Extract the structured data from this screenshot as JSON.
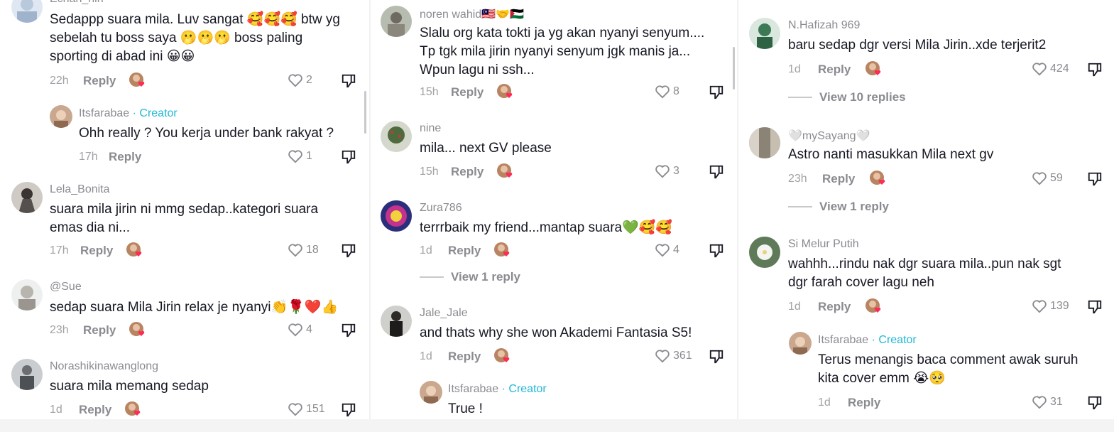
{
  "column1": {
    "c1": {
      "user": "Echan_nin",
      "lines": [
        "Sedappp suara mila. Luv sangat 🥰🥰🥰 btw yg",
        "sebelah tu boss saya 🫢🫢🫢 boss paling",
        "sporting di abad ini 😀😀"
      ],
      "time": "22h",
      "reply": "Reply",
      "likes": "2"
    },
    "c2": {
      "user": "Itsfarabae",
      "creator": "· Creator",
      "lines": [
        "Ohh really ? You kerja under bank rakyat ?"
      ],
      "time": "17h",
      "reply": "Reply",
      "likes": "1"
    },
    "c3": {
      "user": "Lela_Bonita",
      "lines": [
        "suara mila jirin ni mmg sedap..kategori suara",
        "emas dia ni..."
      ],
      "time": "17h",
      "reply": "Reply",
      "likes": "18"
    },
    "c4": {
      "user": "@Sue",
      "lines": [
        "sedap suara Mila Jirin relax je nyanyi👏🌹❤️👍"
      ],
      "time": "23h",
      "reply": "Reply",
      "likes": "4"
    },
    "c5": {
      "user": "Norashikinawanglong",
      "lines": [
        "suara mila memang sedap"
      ],
      "time": "1d",
      "reply": "Reply",
      "likes": "151"
    }
  },
  "column2": {
    "c1": {
      "user": "noren wahid🇲🇾🤝🇵🇸",
      "lines": [
        "Slalu org kata tokti ja yg akan nyanyi senyum....",
        "Tp tgk mila jirin nyanyi senyum jgk manis ja...",
        "Wpun lagu ni ssh..."
      ],
      "time": "15h",
      "reply": "Reply",
      "likes": "8"
    },
    "c2": {
      "user": "nine",
      "lines": [
        "mila... next GV please"
      ],
      "time": "15h",
      "reply": "Reply",
      "likes": "3"
    },
    "c3": {
      "user": "Zura786",
      "lines": [
        "terrrbaik my friend...mantap suara💚🥰🥰"
      ],
      "time": "1d",
      "reply": "Reply",
      "likes": "4",
      "view": "View 1 reply"
    },
    "c4": {
      "user": "Jale_Jale",
      "lines": [
        "and thats why she won Akademi Fantasia S5!"
      ],
      "time": "1d",
      "reply": "Reply",
      "likes": "361"
    },
    "c5": {
      "user": "Itsfarabae",
      "creator": "· Creator",
      "lines": [
        "True !"
      ]
    }
  },
  "column3": {
    "c1": {
      "user": "N.Hafizah 969",
      "lines": [
        "baru sedap dgr versi Mila Jirin..xde terjerit2"
      ],
      "time": "1d",
      "reply": "Reply",
      "likes": "424",
      "view": "View 10 replies"
    },
    "c2": {
      "user": "🤍mySayang🤍",
      "lines": [
        "Astro nanti masukkan Mila next gv"
      ],
      "time": "23h",
      "reply": "Reply",
      "likes": "59",
      "view": "View 1 reply"
    },
    "c3": {
      "user": "Si Melur Putih",
      "lines": [
        "wahhh...rindu nak dgr suara mila..pun nak sgt",
        "dgr farah cover lagu neh"
      ],
      "time": "1d",
      "reply": "Reply",
      "likes": "139"
    },
    "c4": {
      "user": "Itsfarabae",
      "creator": "· Creator",
      "lines": [
        "Terus menangis baca comment awak suruh",
        "kita cover emm 😭🥺"
      ],
      "time": "1d",
      "reply": "Reply",
      "likes": "31"
    }
  },
  "colors": {
    "creator": "#20b8d6",
    "secondary": "#8a8b91",
    "text": "#161823",
    "heart_badge": "#fe2c55"
  }
}
